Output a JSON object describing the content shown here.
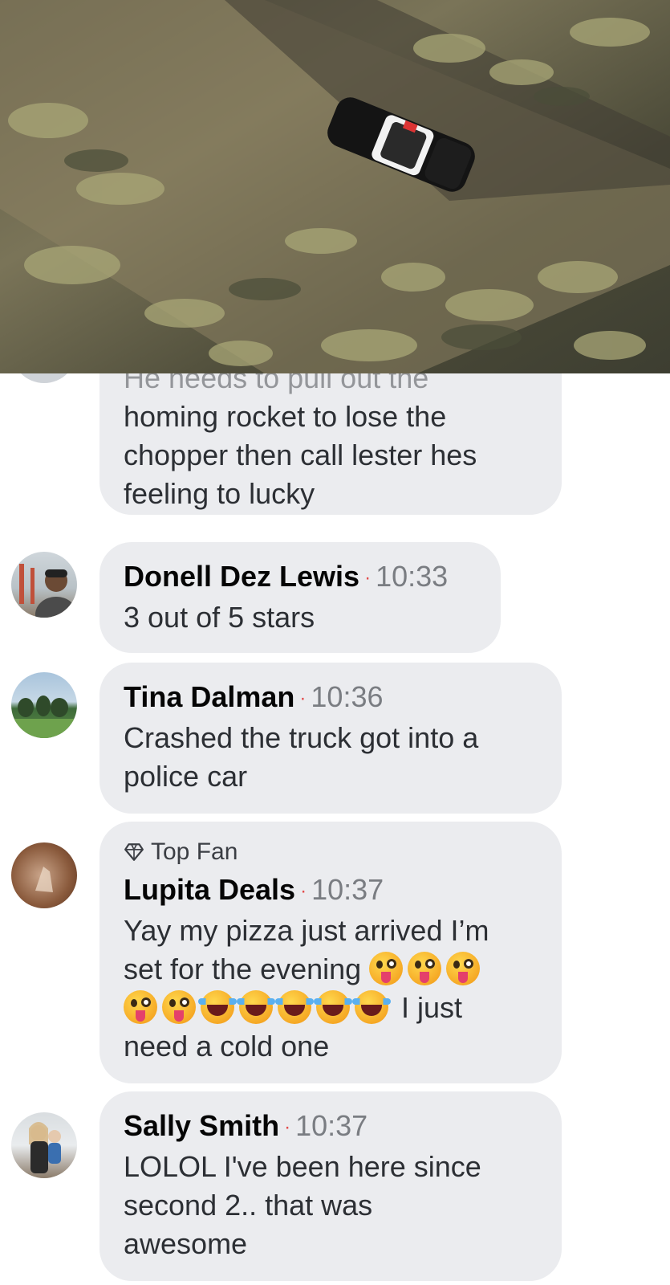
{
  "video": {
    "scene": "aerial view of police car on dirt road"
  },
  "partial_comment": {
    "lines": [
      "He needs to pull out the",
      "homing rocket to lose the",
      "chopper then call lester hes",
      "feeling to lucky"
    ]
  },
  "comments": [
    {
      "author": "Donell Dez Lewis",
      "time": "10:33",
      "text": "3 out of 5 stars",
      "separator": "·"
    },
    {
      "author": "Tina Dalman",
      "time": "10:36",
      "lines": [
        "Crashed the truck got into a",
        "police car"
      ],
      "separator": "·"
    },
    {
      "badge": "Top Fan",
      "badge_icon": "diamond-icon",
      "author": "Lupita Deals",
      "time": "10:37",
      "separator": "·",
      "line1": "Yay my pizza just arrived I’m",
      "line2": "set for the evening",
      "line3_text": "I just",
      "line4": "need a cold one",
      "emoji_line2": [
        "winking-tongue-emoji",
        "winking-tongue-emoji",
        "winking-tongue-emoji"
      ],
      "emoji_line3": [
        "winking-tongue-emoji",
        "winking-tongue-emoji",
        "rolling-laughing-emoji",
        "rolling-laughing-emoji",
        "rolling-laughing-emoji",
        "rolling-laughing-emoji",
        "rolling-laughing-emoji"
      ]
    },
    {
      "author": "Sally Smith",
      "time": "10:37",
      "lines": [
        "LOLOL I've been here since",
        "second 2.. that was",
        "awesome"
      ],
      "separator": "·"
    }
  ],
  "colors": {
    "bubble": "#ebecef",
    "dot": "#e34a4a",
    "timestamp": "#7a7d82"
  }
}
